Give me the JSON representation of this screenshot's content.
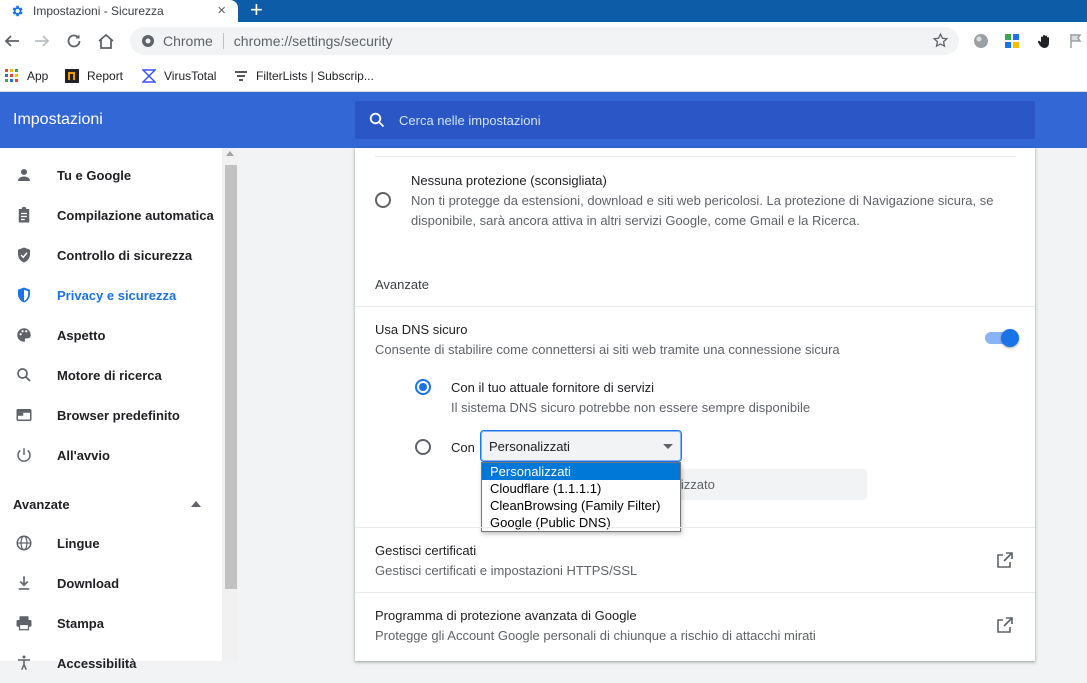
{
  "browser": {
    "tab_title": "Impostazioni - Sicurezza",
    "tab_close": "×",
    "new_tab": "+",
    "site_label": "Chrome",
    "url_prefix": "chrome://",
    "url_path": "settings/security",
    "bookmarks": [
      "App",
      "Report",
      "VirusTotal",
      "FilterLists | Subscrip..."
    ],
    "accent": "#0d5ca8"
  },
  "header": {
    "title": "Impostazioni",
    "search_placeholder": "Cerca nelle impostazioni",
    "color": "#3367d6"
  },
  "sidebar": {
    "items": [
      {
        "label": "Tu e Google",
        "icon": "person-icon"
      },
      {
        "label": "Compilazione automatica",
        "icon": "clipboard-icon"
      },
      {
        "label": "Controllo di sicurezza",
        "icon": "shield-icon"
      },
      {
        "label": "Privacy e sicurezza",
        "icon": "shield-half-icon",
        "active": true
      },
      {
        "label": "Aspetto",
        "icon": "palette-icon"
      },
      {
        "label": "Motore di ricerca",
        "icon": "search-icon"
      },
      {
        "label": "Browser predefinito",
        "icon": "browser-icon"
      },
      {
        "label": "All'avvio",
        "icon": "power-icon"
      }
    ],
    "advanced_label": "Avanzate",
    "advanced_items": [
      {
        "label": "Lingue",
        "icon": "globe-icon"
      },
      {
        "label": "Download",
        "icon": "download-icon"
      },
      {
        "label": "Stampa",
        "icon": "printer-icon"
      },
      {
        "label": "Accessibilità",
        "icon": "accessibility-icon"
      }
    ]
  },
  "main": {
    "no_protection": {
      "title": "Nessuna protezione (sconsigliata)",
      "desc_line1": "Non ti protegge da estensioni, download e siti web pericolosi. La protezione di Navigazione sicura, se",
      "desc_line2": "disponibile, sarà ancora attiva in altri servizi Google, come Gmail e la Ricerca."
    },
    "advanced_heading": "Avanzate",
    "dns": {
      "title": "Usa DNS sicuro",
      "desc": "Consente di stabilire come connettersi ai siti web tramite una connessione sicura",
      "enabled": true,
      "option1_title": "Con il tuo attuale fornitore di servizi",
      "option1_desc": "Il sistema DNS sicuro potrebbe non essere sempre disponibile",
      "option2_label": "Con",
      "selected_provider": "Personalizzati",
      "custom_input_partial": "lizzato",
      "providers": [
        "Personalizzati",
        "Cloudflare (1.1.1.1)",
        "CleanBrowsing (Family Filter)",
        "Google (Public DNS)"
      ]
    },
    "certificates": {
      "title": "Gestisci certificati",
      "desc": "Gestisci certificati e impostazioni HTTPS/SSL"
    },
    "advanced_protection": {
      "title": "Programma di protezione avanzata di Google",
      "desc": "Protegge gli Account Google personali di chiunque a rischio di attacchi mirati"
    }
  }
}
